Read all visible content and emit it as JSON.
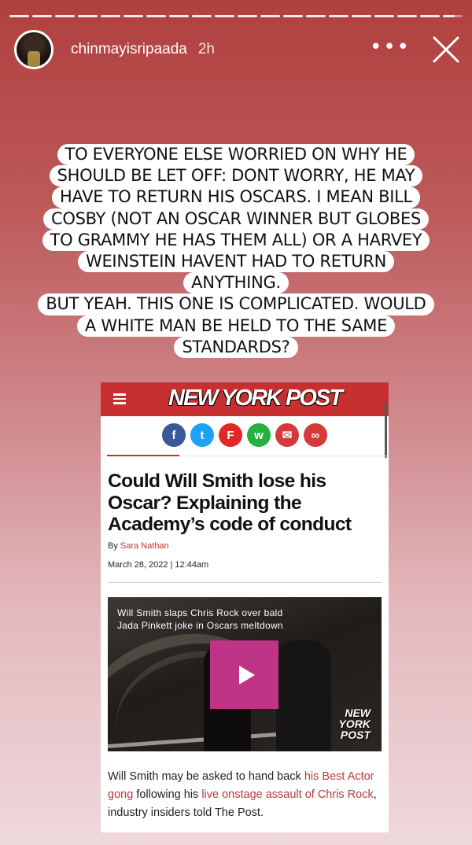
{
  "story": {
    "progress_segments": 20,
    "progress_filled": 19,
    "username": "chinmayisripaada",
    "time": "2h",
    "more_icon": "more-dots-icon",
    "close_icon": "close-icon"
  },
  "caption": {
    "lines": [
      "TO EVERYONE ELSE WORRIED ON WHY HE",
      "SHOULD BE LET OFF: DONT WORRY,  HE MAY",
      "HAVE TO RETURN HIS OSCARS. I MEAN BILL",
      "COSBY (NOT AN OSCAR WINNER BUT GLOBES",
      "TO GRAMMY HE HAS THEM ALL) OR A HARVEY",
      "WEINSTEIN HAVENT HAD TO RETURN",
      "ANYTHING.",
      "BUT YEAH. THIS ONE IS COMPLICATED. WOULD",
      "A WHITE MAN BE HELD TO THE SAME",
      "STANDARDS?"
    ]
  },
  "article": {
    "logo": "NEW YORK POST",
    "brand_color": "#c8302f",
    "share_buttons": [
      {
        "name": "facebook",
        "glyph": "f",
        "color": "#3b5998"
      },
      {
        "name": "twitter",
        "glyph": "t",
        "color": "#1da1f2"
      },
      {
        "name": "flipboard",
        "glyph": "F",
        "color": "#e12828"
      },
      {
        "name": "whatsapp",
        "glyph": "w",
        "color": "#25b13f"
      },
      {
        "name": "email",
        "glyph": "✉",
        "color": "#d6393a"
      },
      {
        "name": "link",
        "glyph": "∞",
        "color": "#d6393a"
      }
    ],
    "headline": "Could Will Smith lose his Oscar? Explaining the Academy’s code of conduct",
    "byline_prefix": "By",
    "author": "Sara Nathan",
    "date": "March 28, 2022 | 12:44am",
    "video": {
      "caption_line1": "Will Smith slaps Chris Rock over bald",
      "caption_line2": "Jada Pinkett joke in Oscars meltdown",
      "watermark": [
        "NEW",
        "YORK",
        "POST"
      ],
      "play_color": "#c03487"
    },
    "body": {
      "t1": "Will Smith may be asked to hand back ",
      "l1": "his Best Actor gong",
      "t2": " following his ",
      "l2": "live onstage assault of Chris Rock",
      "t3": ", industry insiders told The Post."
    }
  }
}
